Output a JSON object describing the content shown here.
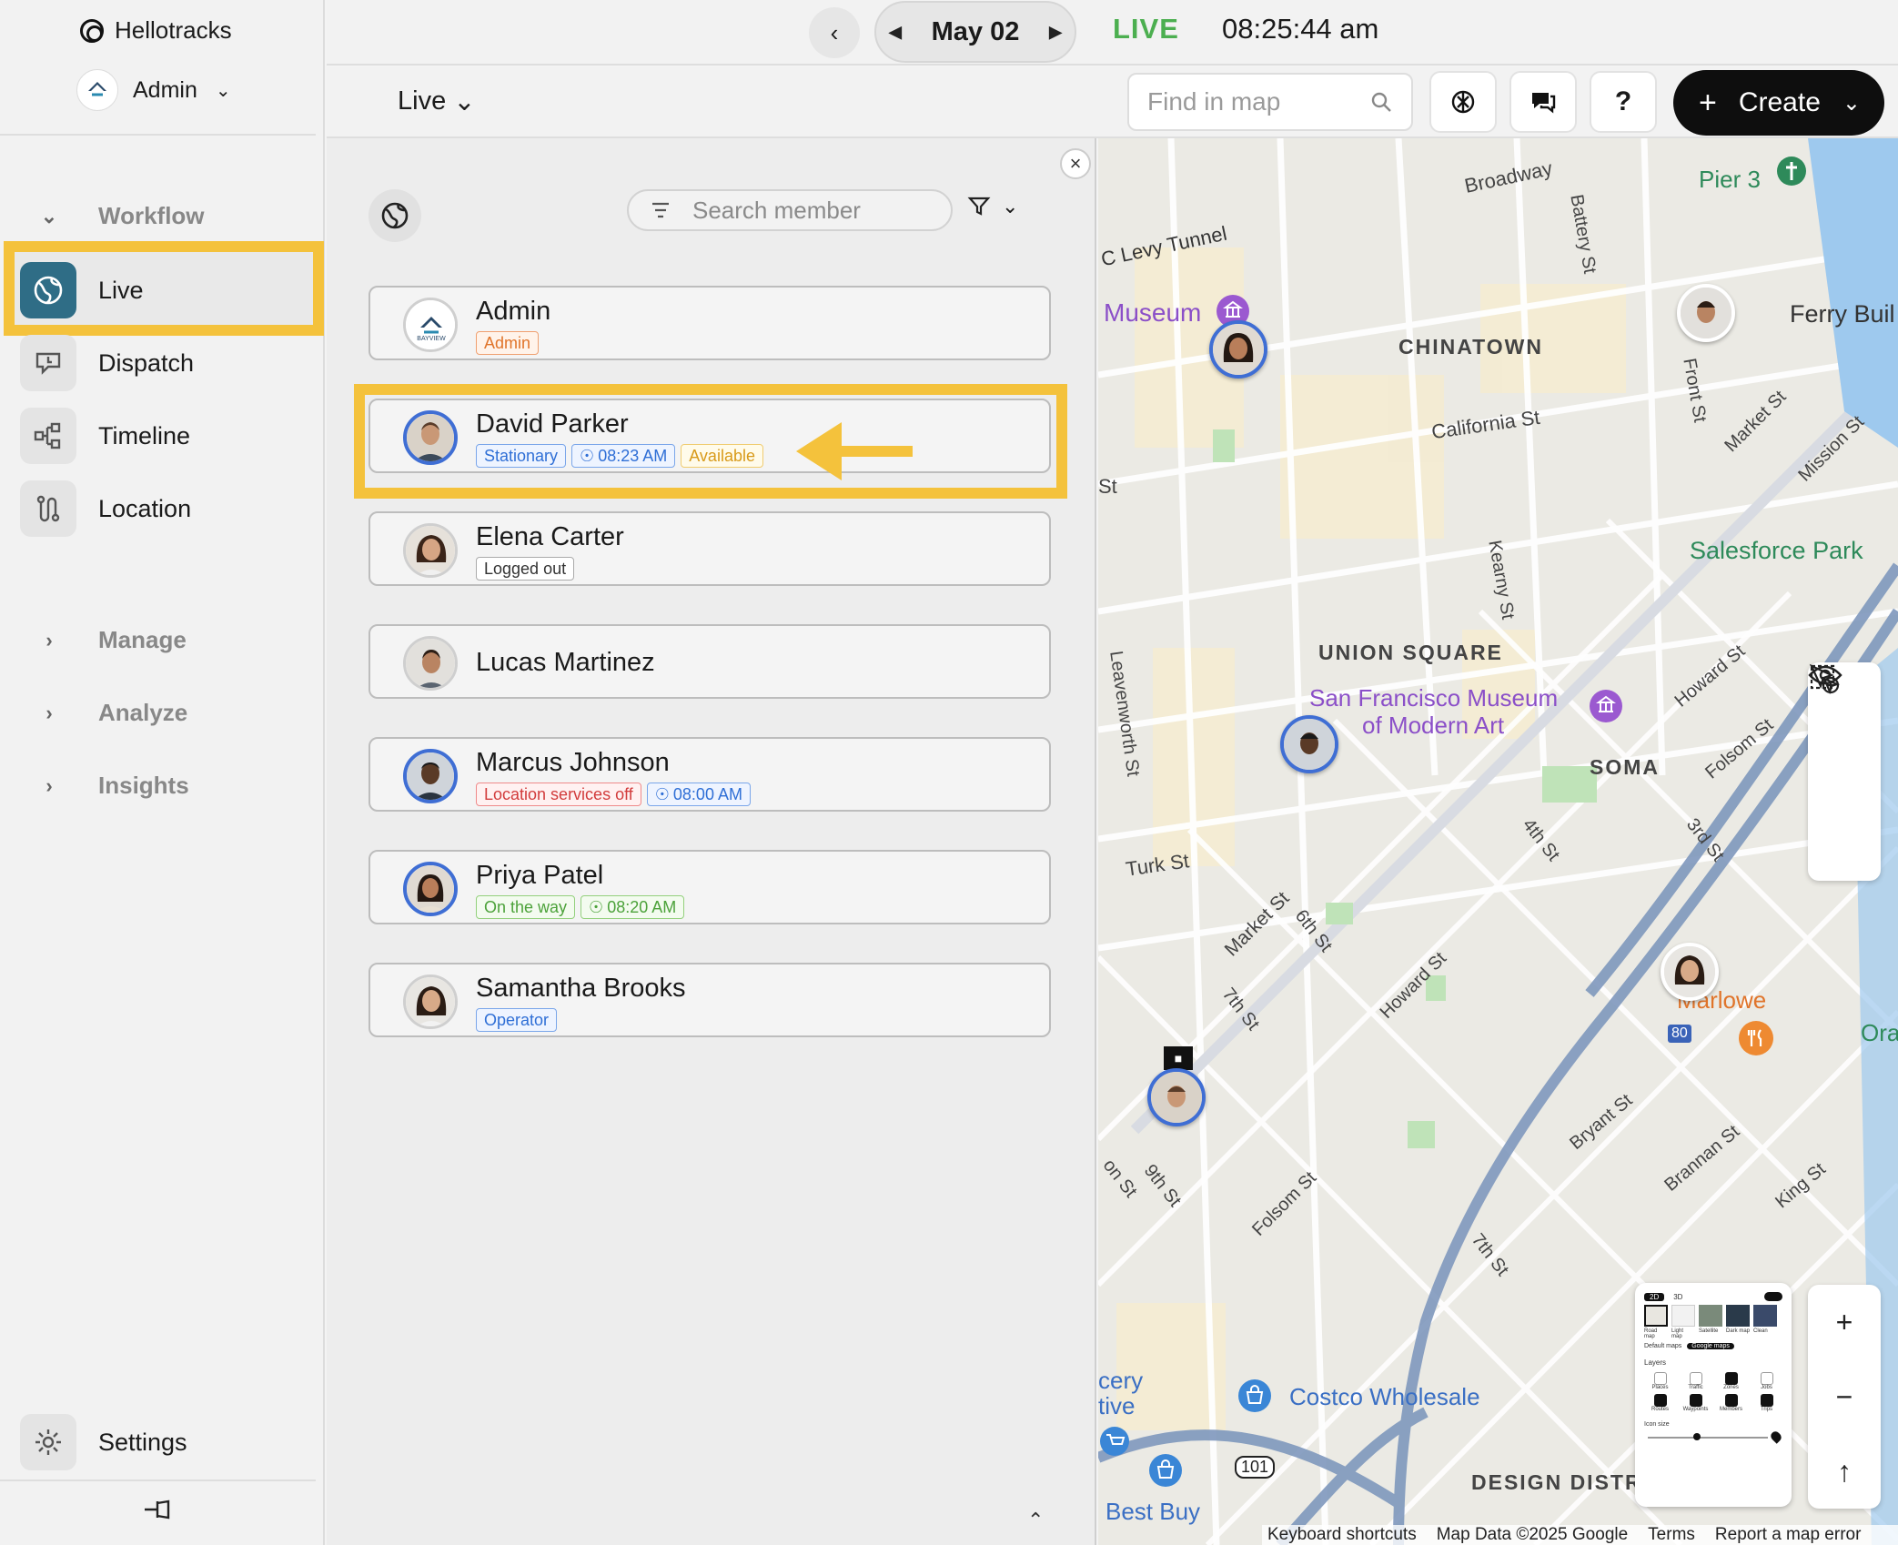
{
  "app": {
    "brand": "Hellotracks",
    "account": "Admin"
  },
  "sidebar": {
    "sections": {
      "workflow": "Workflow",
      "manage": "Manage",
      "analyze": "Analyze",
      "insights": "Insights"
    },
    "items": [
      {
        "label": "Live",
        "icon": "globe-icon",
        "active": true
      },
      {
        "label": "Dispatch",
        "icon": "dispatch-icon"
      },
      {
        "label": "Timeline",
        "icon": "timeline-icon"
      },
      {
        "label": "Location",
        "icon": "route-icon"
      }
    ],
    "settings": "Settings"
  },
  "topbar": {
    "date": "May 02",
    "live": "LIVE",
    "time": "08:25:44 am",
    "view": "Live",
    "find_placeholder": "Find in map",
    "help": "?",
    "create": "Create"
  },
  "panel": {
    "search_placeholder": "Search member",
    "members": [
      {
        "name": "Admin",
        "tags": [
          {
            "text": "Admin",
            "color": "orange"
          }
        ]
      },
      {
        "name": "David Parker",
        "tags": [
          {
            "text": "Stationary",
            "color": "blue"
          },
          {
            "text": "08:23 AM",
            "color": "blue",
            "icon": "person-icon"
          },
          {
            "text": "Available",
            "color": "yellow"
          }
        ]
      },
      {
        "name": "Elena Carter",
        "tags": [
          {
            "text": "Logged out",
            "color": "gray"
          }
        ]
      },
      {
        "name": "Lucas Martinez",
        "tags": []
      },
      {
        "name": "Marcus Johnson",
        "tags": [
          {
            "text": "Location services off",
            "color": "red"
          },
          {
            "text": "08:00 AM",
            "color": "blue",
            "icon": "person-icon"
          }
        ]
      },
      {
        "name": "Priya Patel",
        "tags": [
          {
            "text": "On the way",
            "color": "green"
          },
          {
            "text": "08:20 AM",
            "color": "green",
            "icon": "person-icon"
          }
        ]
      },
      {
        "name": "Samantha Brooks",
        "tags": [
          {
            "text": "Operator",
            "color": "blue"
          }
        ]
      }
    ]
  },
  "map": {
    "labels": {
      "broadway": "Broadway",
      "pier3": "Pier 3",
      "levy": "C Levy Tunnel",
      "battery": "Battery St",
      "museum": "Museum",
      "chinatown": "CHINATOWN",
      "ferry": "Ferry Buil",
      "front": "Front St",
      "california": "California St",
      "market_top": "Market St",
      "mission": "Mission St",
      "st": "St",
      "kearny": "Kearny St",
      "salesforce": "Salesforce Park",
      "union": "UNION SQUARE",
      "leavenworth": "Leavenworth St",
      "sfmoma1": "San Francisco Museum",
      "sfmoma2": "of Modern Art",
      "howard_top": "Howard St",
      "soma": "SOMA",
      "folsom_top": "Folsom St",
      "fourth": "4th St",
      "third": "3rd St",
      "turk": "Turk St",
      "market": "Market St",
      "sixth": "6th St",
      "howard": "Howard St",
      "seventh": "7th St",
      "marlowe": "Marlowe",
      "ora": "Ora",
      "eighty": "80",
      "bryant": "Bryant St",
      "brannan": "Brannan St",
      "king": "King St",
      "ninth": "9th St",
      "folsom": "Folsom St",
      "seventh_b": "7th St",
      "on_st": "on St",
      "costco": "Costco Wholesale",
      "cery": "cery",
      "tive": "tive",
      "bestbuy": "Best Buy",
      "hwy101": "101",
      "design": "DESIGN DISTR"
    },
    "layers": {
      "tab2d": "2D",
      "tab3d": "3D",
      "styles": [
        "Road map",
        "Light map",
        "Satellite",
        "Dark map",
        "Clean"
      ],
      "default_maps": "Default maps",
      "google_maps": "Google maps",
      "layers_title": "Layers",
      "layer_items": [
        "Places",
        "Traffic",
        "Zones",
        "Jobs",
        "Routes",
        "Waypoints",
        "Members",
        "Trips"
      ],
      "icon_size": "Icon size"
    },
    "zoom_in": "+",
    "zoom_out": "−",
    "footer": {
      "shortcuts": "Keyboard shortcuts",
      "mapdata": "Map Data ©2025 Google",
      "terms": "Terms",
      "report": "Report a map error"
    }
  },
  "colors": {
    "highlight": "#f4c23c",
    "live_green": "#4caf50",
    "active_nav": "#2f6d86",
    "avatar_ring": "#3f6ed4"
  }
}
